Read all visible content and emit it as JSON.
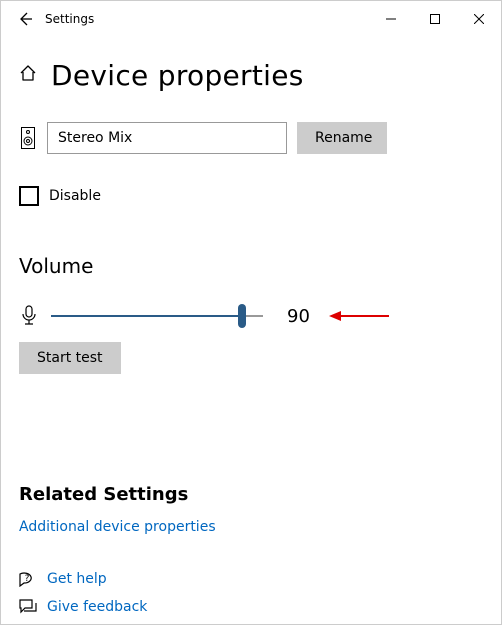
{
  "window": {
    "title": "Settings"
  },
  "page": {
    "heading": "Device properties"
  },
  "device": {
    "name_value": "Stereo Mix",
    "rename_label": "Rename",
    "disable_label": "Disable"
  },
  "volume": {
    "heading": "Volume",
    "value": "90",
    "percent": 90,
    "start_test_label": "Start test"
  },
  "related": {
    "heading": "Related Settings",
    "additional_label": "Additional device properties"
  },
  "footer": {
    "get_help_label": "Get help",
    "feedback_label": "Give feedback"
  }
}
